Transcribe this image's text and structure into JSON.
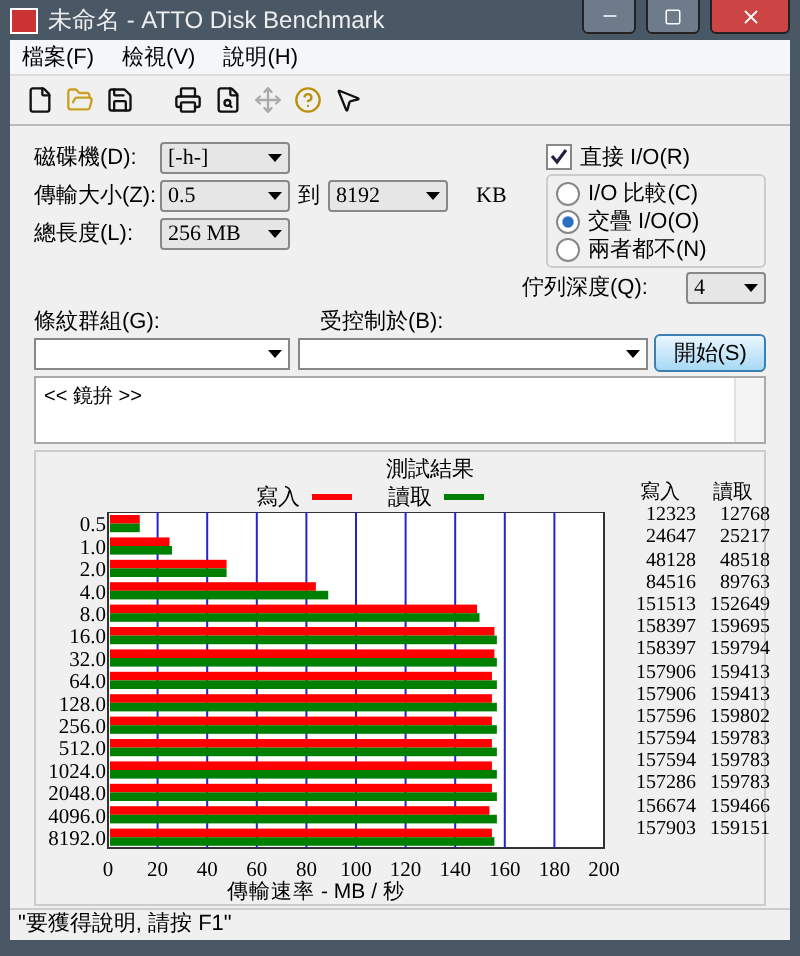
{
  "window": {
    "title": "未命名 - ATTO Disk Benchmark"
  },
  "menu": [
    "檔案(F)",
    "檢視(V)",
    "說明(H)"
  ],
  "form": {
    "drive": {
      "label": "磁碟機(D):",
      "value": "[-h-]"
    },
    "transfer_size": {
      "label": "傳輸大小(Z):",
      "from": "0.5",
      "to_label": "到",
      "to": "8192",
      "unit": "KB"
    },
    "total_length": {
      "label": "總長度(L):",
      "value": "256 MB"
    },
    "direct_io": {
      "label": "直接 I/O(R)",
      "checked": true
    },
    "io_modes": [
      {
        "label": "I/O 比較(C)",
        "selected": false
      },
      {
        "label": "交疊 I/O(O)",
        "selected": true
      },
      {
        "label": "兩者都不(N)",
        "selected": false
      }
    ],
    "queue_depth": {
      "label": "佇列深度(Q):",
      "value": "4"
    },
    "stripe_group": {
      "label": "條紋群組(G):"
    },
    "controlled_by": {
      "label": "受控制於(B):"
    },
    "start_button": "開始(S)",
    "log": "<< 鏡拚 >>"
  },
  "results": {
    "chart_data": {
      "type": "bar",
      "orientation": "horizontal",
      "title": "測試結果",
      "xlabel": "傳輸速率 - MB / 秒",
      "categories": [
        "0.5",
        "1.0",
        "2.0",
        "4.0",
        "8.0",
        "16.0",
        "32.0",
        "64.0",
        "128.0",
        "256.0",
        "512.0",
        "1024.0",
        "2048.0",
        "4096.0",
        "8192.0"
      ],
      "xlim": [
        0,
        200
      ],
      "grid": true,
      "xticks": [
        0,
        20,
        40,
        60,
        80,
        100,
        120,
        140,
        160,
        180,
        200
      ],
      "series": [
        {
          "name": "寫入",
          "color": "#ff0000",
          "values": [
            12,
            24,
            47,
            83,
            148,
            155,
            155,
            154,
            154,
            154,
            154,
            154,
            154,
            153,
            154
          ]
        },
        {
          "name": "讀取",
          "color": "#008000",
          "values": [
            12,
            25,
            47,
            88,
            149,
            156,
            156,
            156,
            156,
            156,
            156,
            156,
            156,
            156,
            155
          ]
        }
      ]
    },
    "table": {
      "columns": [
        "寫入",
        "讀取"
      ],
      "rows": [
        [
          "12323",
          "12768"
        ],
        [
          "24647",
          "25217"
        ],
        [
          "48128",
          "48518"
        ],
        [
          "84516",
          "89763"
        ],
        [
          "151513",
          "152649"
        ],
        [
          "158397",
          "159695"
        ],
        [
          "158397",
          "159794"
        ],
        [
          "157906",
          "159413"
        ],
        [
          "157906",
          "159413"
        ],
        [
          "157596",
          "159802"
        ],
        [
          "157594",
          "159783"
        ],
        [
          "157594",
          "159783"
        ],
        [
          "157286",
          "159783"
        ],
        [
          "156674",
          "159466"
        ],
        [
          "157903",
          "159151"
        ]
      ]
    }
  },
  "status_bar": "\"要獲得說明, 請按 F1\""
}
